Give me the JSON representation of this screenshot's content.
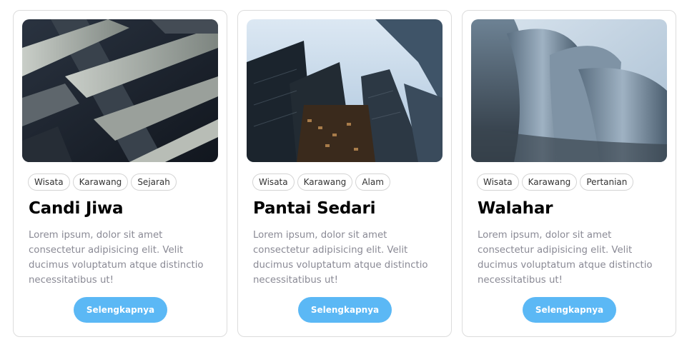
{
  "cards": [
    {
      "image": "abstract-metal-facade-photo",
      "tags": [
        "Wisata",
        "Karawang",
        "Sejarah"
      ],
      "title": "Candi Jiwa",
      "description": "Lorem ipsum, dolor sit amet consectetur adipisicing elit. Velit ducimus voluptatum atque distinctio necessitatibus ut!",
      "button_label": "Selengkapnya"
    },
    {
      "image": "skyscrapers-looking-up-photo",
      "tags": [
        "Wisata",
        "Karawang",
        "Alam"
      ],
      "title": "Pantai Sedari",
      "description": "Lorem ipsum, dolor sit amet consectetur adipisicing elit. Velit ducimus voluptatum atque distinctio necessitatibus ut!",
      "button_label": "Selengkapnya"
    },
    {
      "image": "curved-steel-building-photo",
      "tags": [
        "Wisata",
        "Karawang",
        "Pertanian"
      ],
      "title": "Walahar",
      "description": "Lorem ipsum, dolor sit amet consectetur adipisicing elit. Velit ducimus voluptatum atque distinctio necessitatibus ut!",
      "button_label": "Selengkapnya"
    }
  ],
  "colors": {
    "button": "#5bb8f5",
    "description_text": "#8a8a95",
    "card_border": "#dcdcdc"
  }
}
